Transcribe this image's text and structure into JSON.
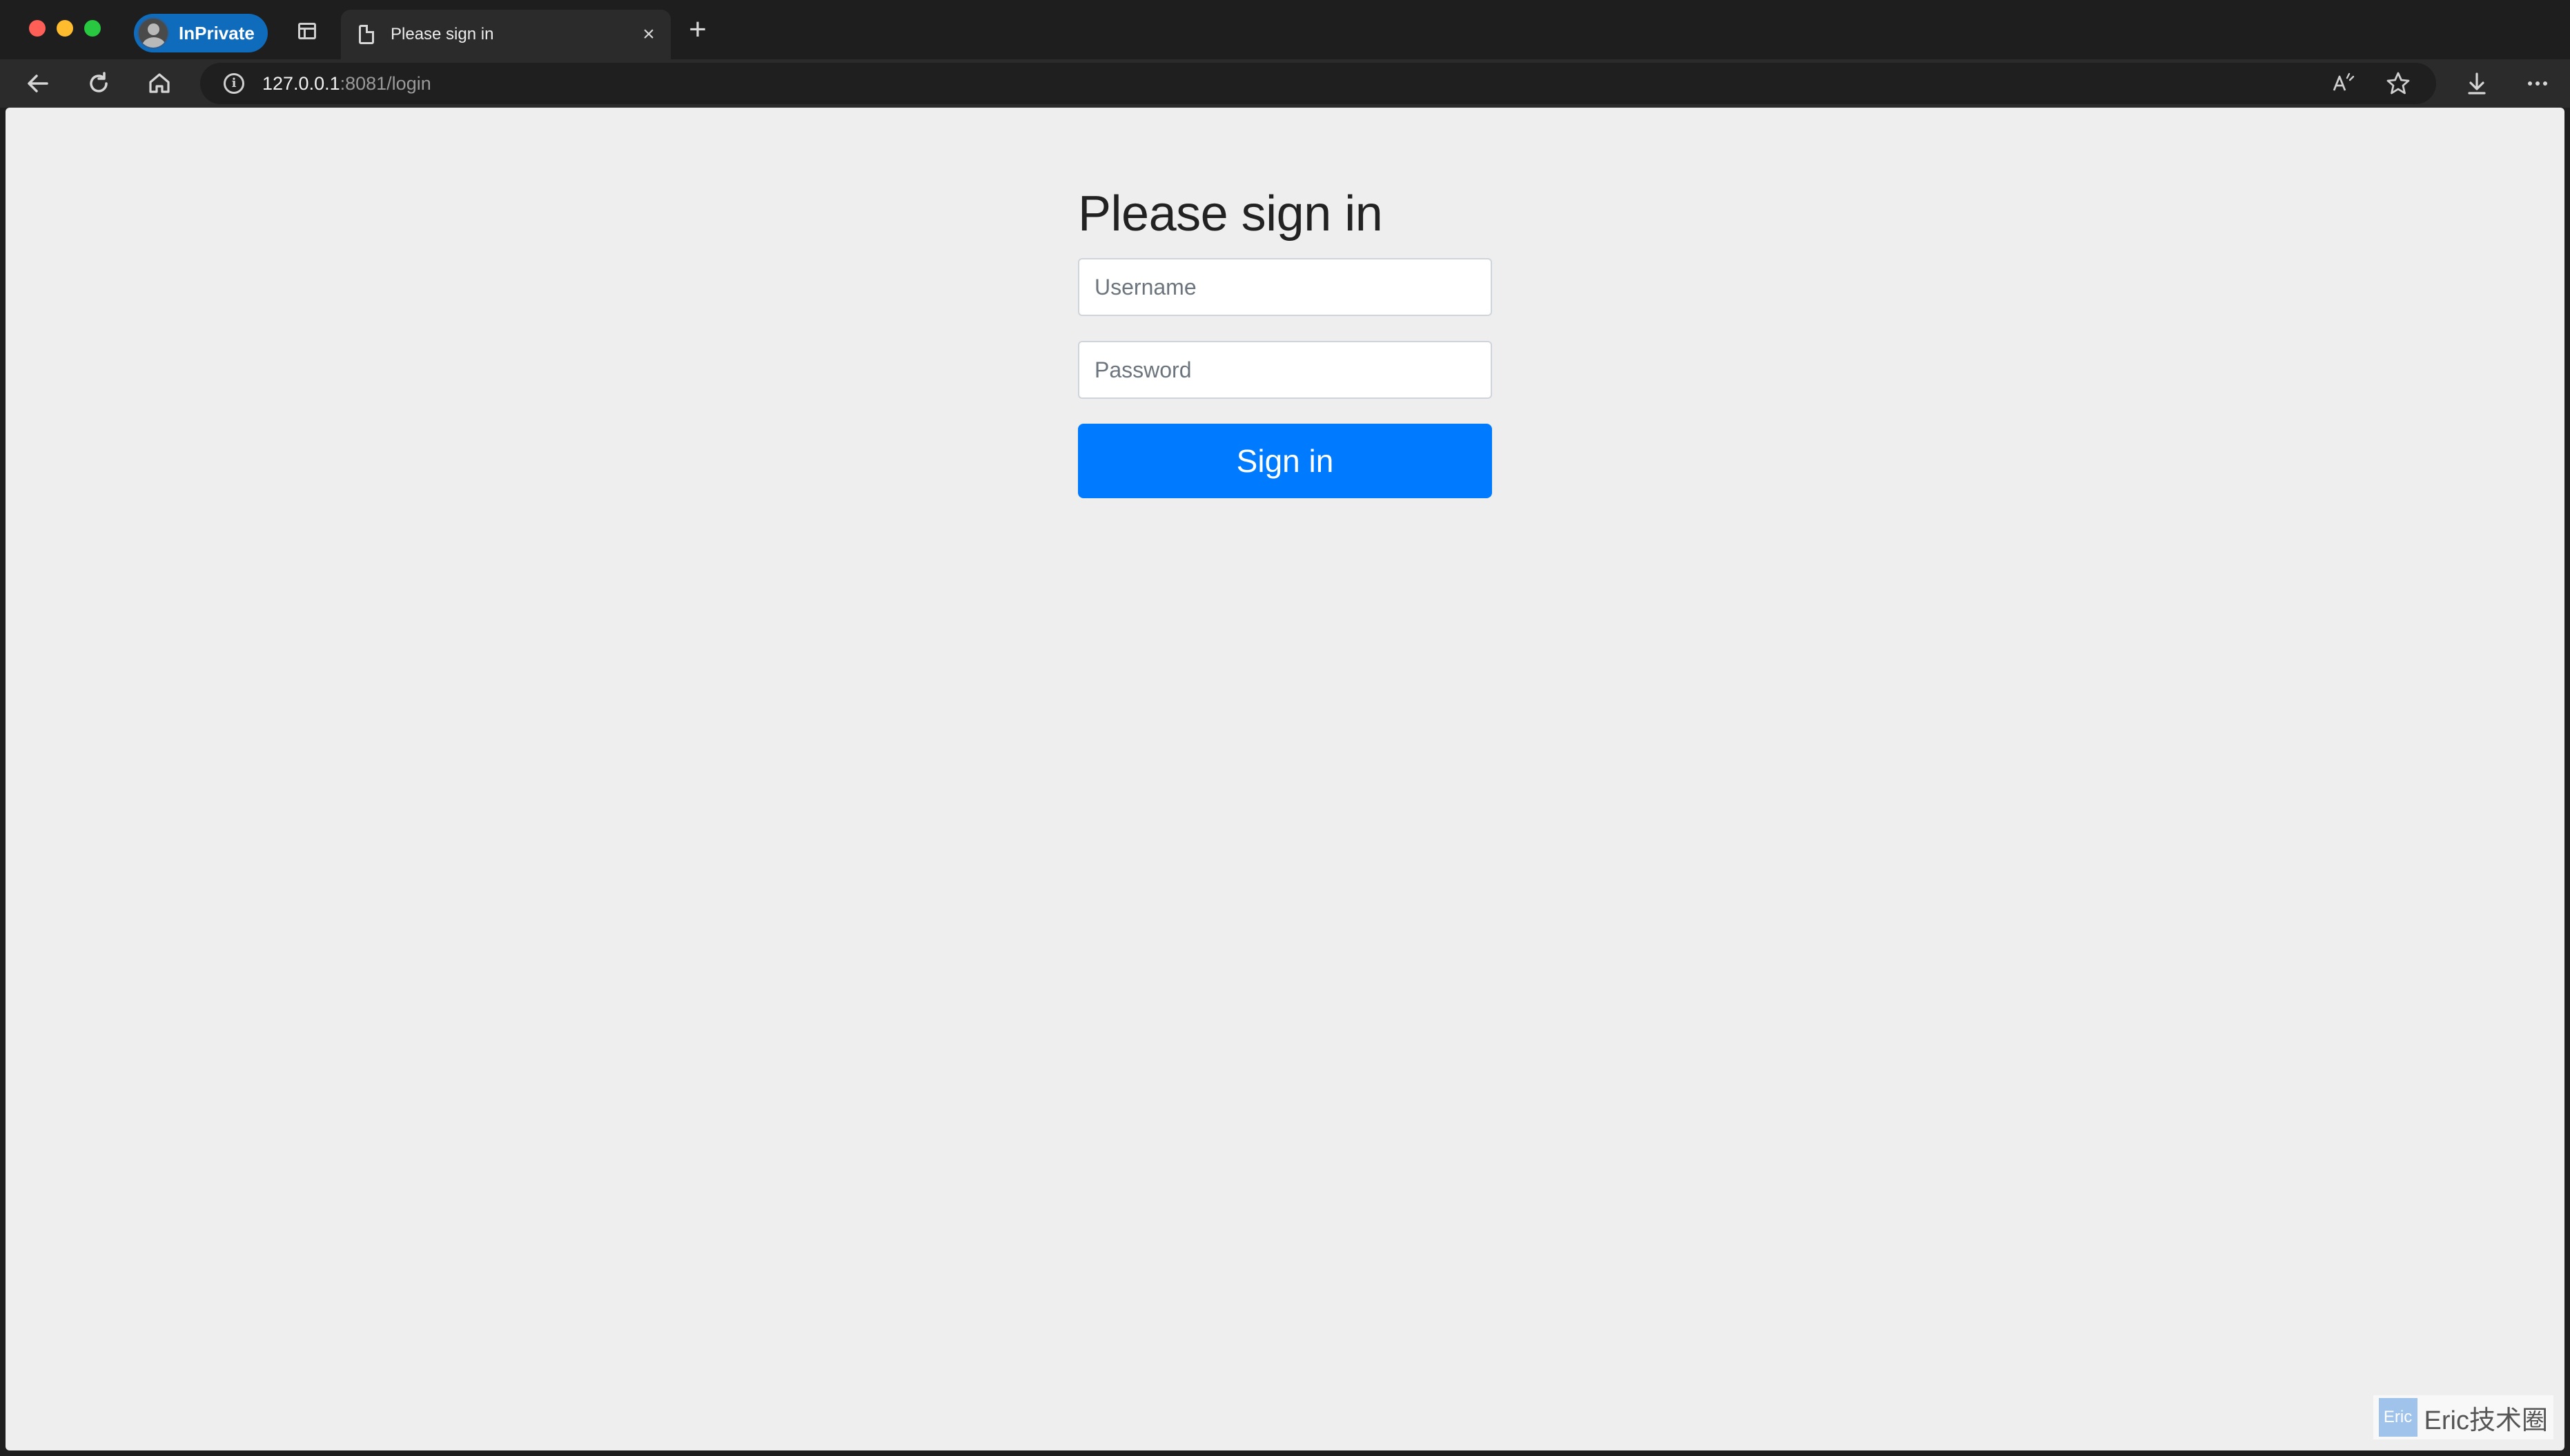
{
  "browser": {
    "profile_label": "InPrivate",
    "tab_title": "Please sign in",
    "tab_close": "×",
    "new_tab": "+",
    "url_host": "127.0.0.1",
    "url_path": ":8081/login",
    "icons": {
      "back": "back-arrow-icon",
      "refresh": "refresh-icon",
      "home": "home-icon",
      "info": "info-icon",
      "read_aloud": "read-aloud-icon",
      "favorite": "star-icon",
      "downloads": "download-icon",
      "more": "more-icon"
    }
  },
  "form": {
    "heading": "Please sign in",
    "username_placeholder": "Username",
    "password_placeholder": "Password",
    "submit_label": "Sign in"
  },
  "watermark": {
    "badge": "Eric",
    "text": "Eric技术圈"
  },
  "colors": {
    "primary_button": "#007bff",
    "page_background": "#eeeeee",
    "inprivate_pill": "#0f6cbd"
  }
}
